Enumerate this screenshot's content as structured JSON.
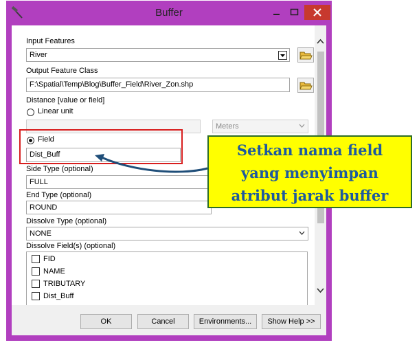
{
  "window": {
    "title": "Buffer"
  },
  "input_features": {
    "label": "Input Features",
    "value": "River"
  },
  "output_feature_class": {
    "label": "Output Feature Class",
    "value": "F:\\Spatial\\Temp\\Blog\\Buffer_Field\\River_Zon.shp"
  },
  "distance": {
    "label": "Distance [value or field]",
    "linear_unit_label": "Linear unit",
    "linear_unit_value": "",
    "unit": "Meters",
    "field_label": "Field",
    "field_value": "Dist_Buff"
  },
  "side_type": {
    "label": "Side Type (optional)",
    "value": "FULL"
  },
  "end_type": {
    "label": "End Type (optional)",
    "value": "ROUND"
  },
  "dissolve_type": {
    "label": "Dissolve Type (optional)",
    "value": "NONE"
  },
  "dissolve_fields": {
    "label": "Dissolve Field(s) (optional)",
    "items": [
      "FID",
      "NAME",
      "TRIBUTARY",
      "Dist_Buff"
    ]
  },
  "buttons": {
    "ok": "OK",
    "cancel": "Cancel",
    "environments": "Environments...",
    "show_help": "Show Help >>"
  },
  "callout": {
    "lines": [
      "Setkan nama field",
      "yang menyimpan",
      "atribut jarak buffer"
    ]
  },
  "colors": {
    "window_frame": "#b13fbf",
    "highlight_box": "#d81e1e",
    "callout_bg": "#ffff00",
    "callout_text": "#1e5a9e"
  }
}
